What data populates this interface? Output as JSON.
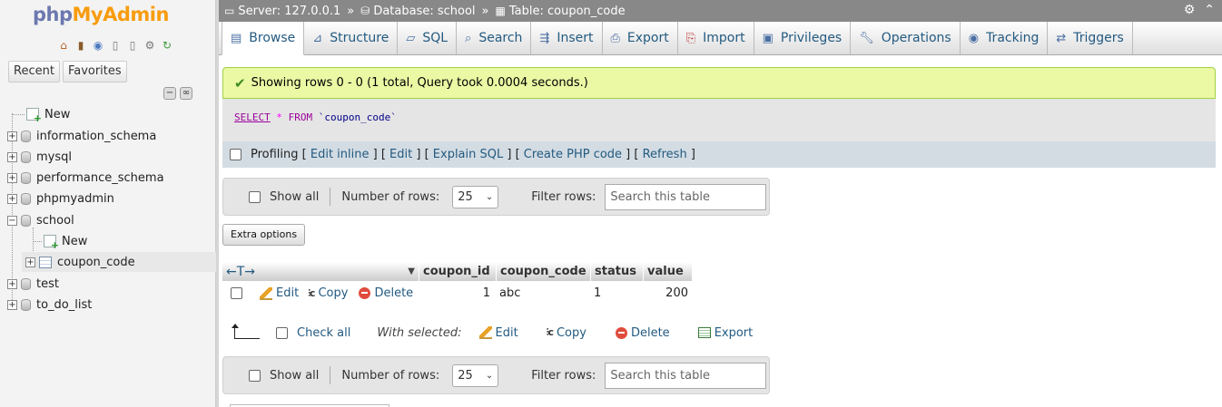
{
  "app": {
    "logo_php": "php",
    "logo_myadmin": "MyAdmin",
    "recent_label": "Recent",
    "favorites_label": "Favorites"
  },
  "tree": {
    "items": [
      {
        "label": "New"
      },
      {
        "label": "information_schema"
      },
      {
        "label": "mysql"
      },
      {
        "label": "performance_schema"
      },
      {
        "label": "phpmyadmin"
      },
      {
        "label": "school"
      },
      {
        "label": "New"
      },
      {
        "label": "coupon_code"
      },
      {
        "label": "test"
      },
      {
        "label": "to_do_list"
      }
    ]
  },
  "breadcrumb": {
    "server": "Server: 127.0.0.1",
    "database": "Database: school",
    "table": "Table: coupon_code",
    "sep": "»"
  },
  "tabs": [
    {
      "label": "Browse",
      "icon": "browse-icon"
    },
    {
      "label": "Structure",
      "icon": "structure-icon"
    },
    {
      "label": "SQL",
      "icon": "sql-icon"
    },
    {
      "label": "Search",
      "icon": "search-icon"
    },
    {
      "label": "Insert",
      "icon": "insert-icon"
    },
    {
      "label": "Export",
      "icon": "export-icon"
    },
    {
      "label": "Import",
      "icon": "import-icon"
    },
    {
      "label": "Privileges",
      "icon": "privileges-icon"
    },
    {
      "label": "Operations",
      "icon": "operations-icon"
    },
    {
      "label": "Tracking",
      "icon": "tracking-icon"
    },
    {
      "label": "Triggers",
      "icon": "triggers-icon"
    }
  ],
  "message": {
    "text": "Showing rows 0 - 0 (1 total, Query took 0.0004 seconds.)"
  },
  "sql": {
    "select": "SELECT",
    "star": "*",
    "from": "FROM",
    "table": "`coupon_code`"
  },
  "profiling": {
    "label": "Profiling",
    "links": [
      "Edit inline",
      "Edit",
      "Explain SQL",
      "Create PHP code",
      "Refresh"
    ]
  },
  "navbar": {
    "show_all": "Show all",
    "num_rows_label": "Number of rows:",
    "num_rows_value": "25",
    "filter_label": "Filter rows:",
    "filter_placeholder": "Search this table"
  },
  "extra_options": "Extra options",
  "table": {
    "columns": [
      "coupon_id",
      "coupon_code",
      "status",
      "value"
    ],
    "rows": [
      {
        "coupon_id": "1",
        "coupon_code": "abc",
        "status": "1",
        "value": "200"
      }
    ],
    "row_actions": {
      "edit": "Edit",
      "copy": "Copy",
      "delete": "Delete"
    }
  },
  "with_selected": {
    "check_all": "Check all",
    "label": "With selected:",
    "edit": "Edit",
    "copy": "Copy",
    "delete": "Delete",
    "export": "Export"
  }
}
